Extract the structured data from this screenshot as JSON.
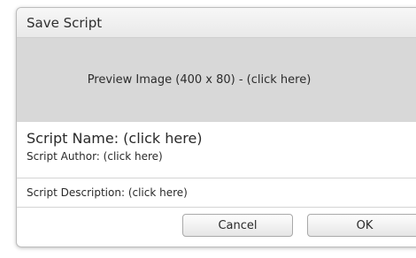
{
  "dialog": {
    "title": "Save Script",
    "preview_label": "Preview Image (400 x 80) - (click here)",
    "script_name_label": "Script Name: (click here)",
    "script_author_label": "Script Author: (click here)",
    "script_description_label": "Script Description: (click here)",
    "cancel_label": "Cancel",
    "ok_label": "OK"
  }
}
